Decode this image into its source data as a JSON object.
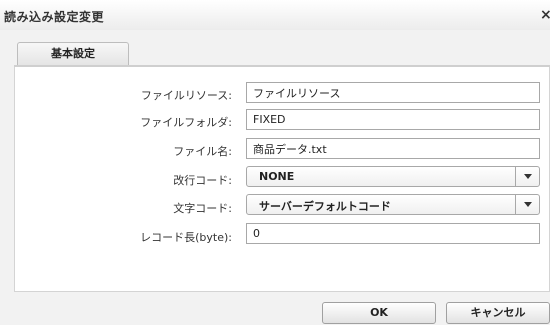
{
  "dialog": {
    "title": "読み込み設定変更",
    "close_glyph": "×"
  },
  "tabs": [
    {
      "label": "基本設定"
    }
  ],
  "form": {
    "file_resource": {
      "label": "ファイルリソース:",
      "value": "ファイルリソース"
    },
    "file_folder": {
      "label": "ファイルフォルダ:",
      "value": "FIXED"
    },
    "file_name": {
      "label": "ファイル名:",
      "value": "商品データ.txt"
    },
    "newline_code": {
      "label": "改行コード:",
      "value": "NONE"
    },
    "char_code": {
      "label": "文字コード:",
      "value": "サーバーデフォルトコード"
    },
    "record_length": {
      "label": "レコード長(byte):",
      "value": "0"
    }
  },
  "buttons": {
    "ok": "OK",
    "cancel": "キャンセル"
  }
}
